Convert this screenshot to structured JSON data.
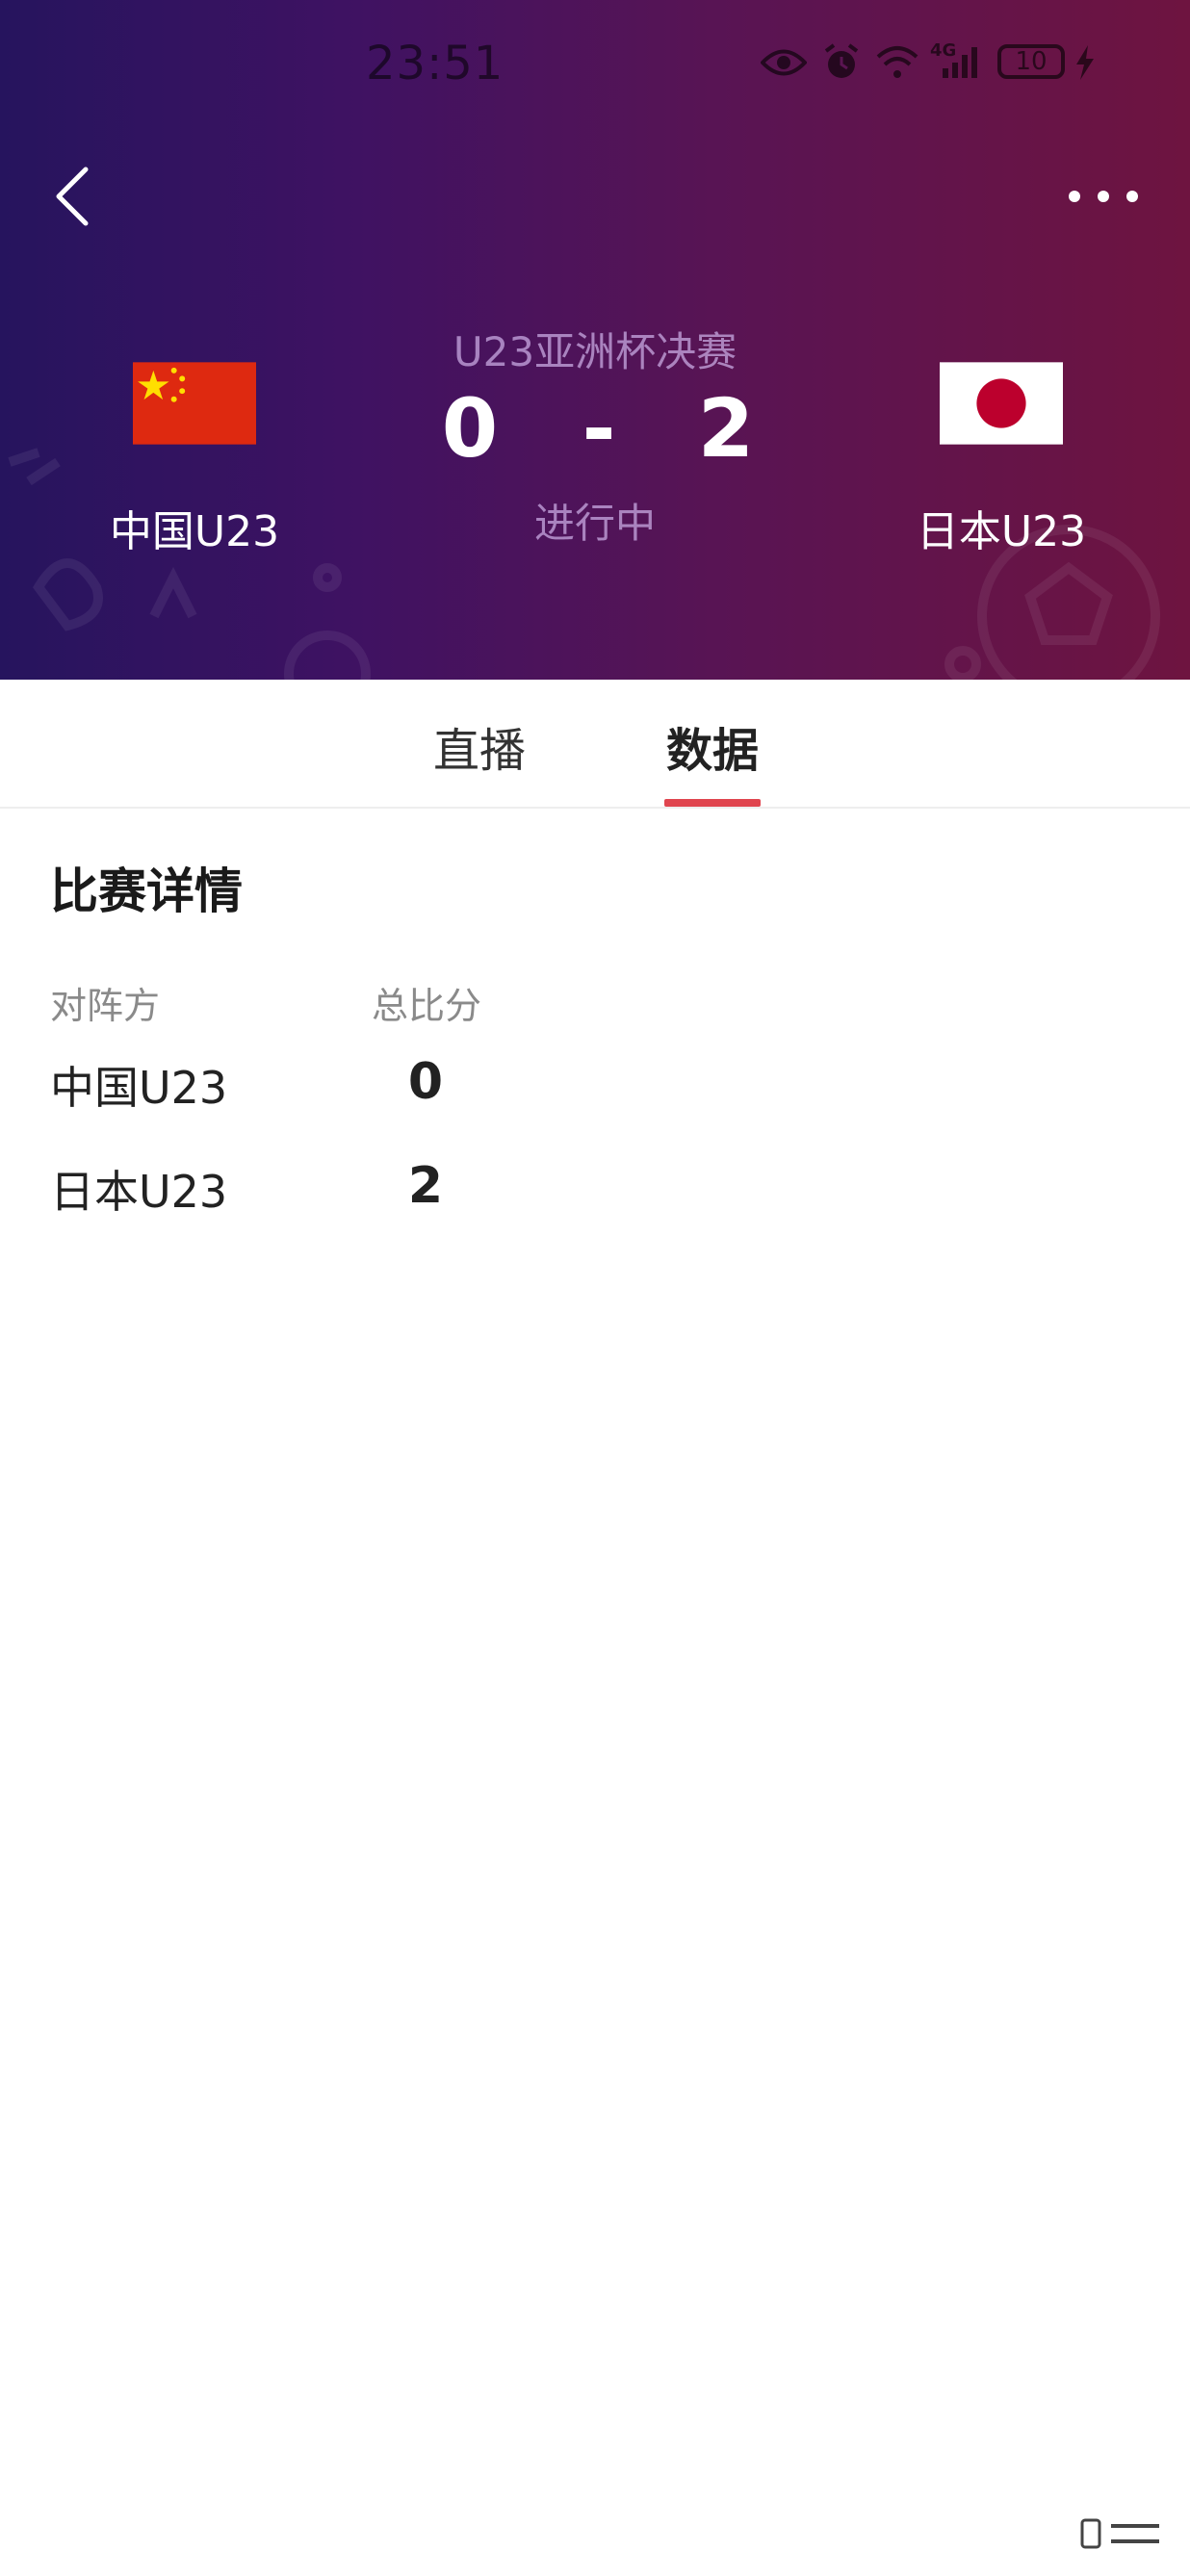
{
  "status_bar": {
    "time": "23:51",
    "network_label": "4G",
    "battery": "10",
    "icons": [
      "eye-icon",
      "alarm-icon",
      "wifi-icon",
      "signal-icon",
      "battery-icon",
      "charging-icon"
    ]
  },
  "header": {
    "match_title": "U23亚洲杯决赛",
    "home_score": "0",
    "separator": "-",
    "away_score": "2",
    "status": "进行中",
    "home_team": "中国U23",
    "away_team": "日本U23",
    "colors": {
      "gradient_start": "#26145e",
      "gradient_end": "#6e1440"
    }
  },
  "tabs": [
    {
      "label": "直播",
      "active": false
    },
    {
      "label": "数据",
      "active": true
    }
  ],
  "accent_color": "#e0454f",
  "details": {
    "title": "比赛详情",
    "columns": [
      "对阵方",
      "总比分"
    ],
    "rows": [
      {
        "team": "中国U23",
        "total": "0"
      },
      {
        "team": "日本U23",
        "total": "2"
      }
    ]
  }
}
